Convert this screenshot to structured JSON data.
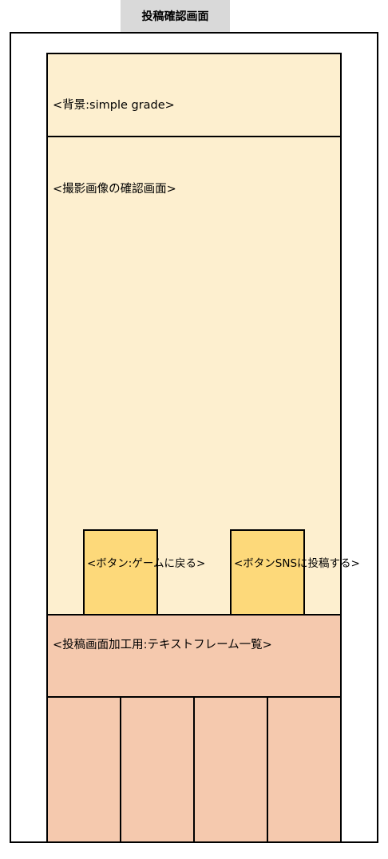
{
  "screen_title": "投稿確認画面",
  "sections": {
    "background_label": "<背景:simple grade>",
    "preview_label": "<撮影画像の確認画面>",
    "frames_label": "<投稿画面加工用:テキストフレーム一覧>"
  },
  "buttons": {
    "back_label": "<ボタン:ゲームに戻る>",
    "post_label": "<ボタンSNSに投稿する>"
  },
  "frame_list": {
    "cells": [
      "",
      "",
      "",
      ""
    ]
  },
  "colors": {
    "tab": "#d9d9d9",
    "cream": "#fdefcf",
    "button": "#fdd97a",
    "salmon": "#f5c9ae"
  }
}
